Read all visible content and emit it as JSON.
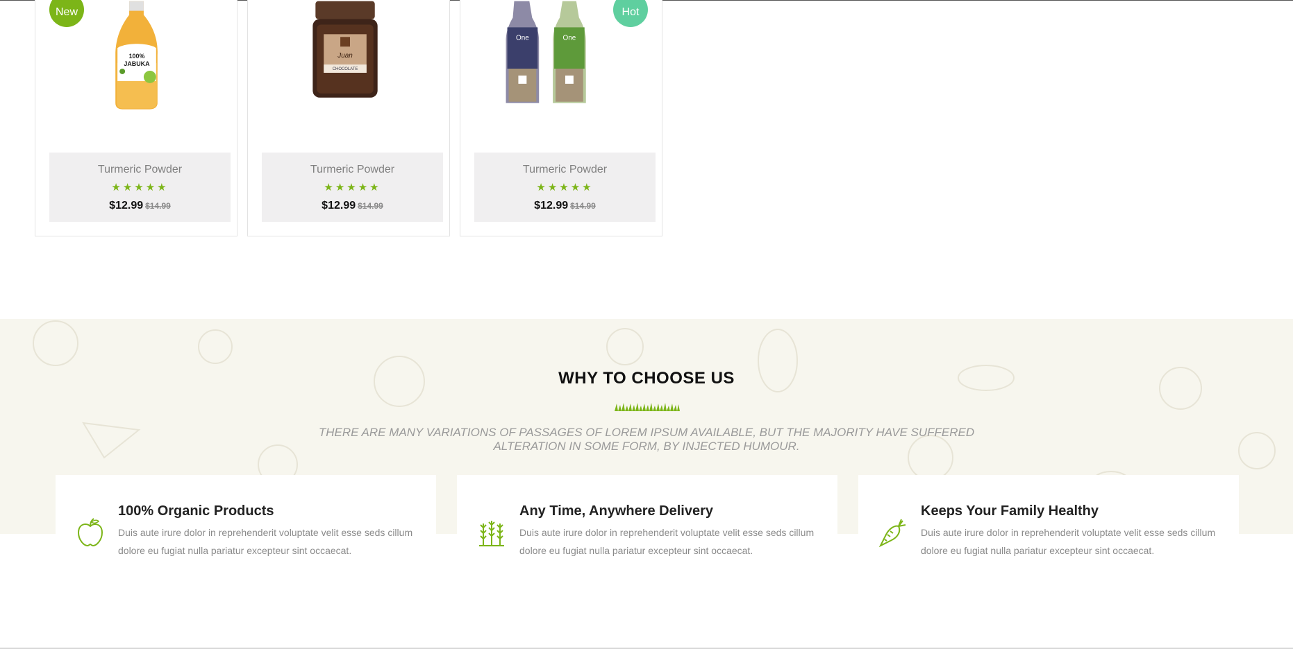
{
  "products": [
    {
      "name": "Turmeric Powder",
      "stars": "★★★★★",
      "price": "$12.99",
      "old_price": "$14.99",
      "badge": "New",
      "image": "juice-bottle"
    },
    {
      "name": "Turmeric Powder",
      "stars": "★★★★★",
      "price": "$12.99",
      "old_price": "$14.99",
      "badge": "",
      "image": "coffee-jar"
    },
    {
      "name": "Turmeric Powder",
      "stars": "★★★★★",
      "price": "$12.99",
      "old_price": "$14.99",
      "badge": "Hot",
      "image": "bread-bags"
    }
  ],
  "why": {
    "title": "WHY TO CHOOSE US",
    "subtitle": "THERE ARE MANY VARIATIONS OF PASSAGES OF LOREM IPSUM AVAILABLE, BUT THE MAJORITY HAVE SUFFERED ALTERATION IN SOME FORM, BY INJECTED HUMOUR.",
    "features": [
      {
        "title": "100% Organic Products",
        "desc": "Duis aute irure dolor in reprehenderit voluptate velit esse seds cillum dolore eu fugiat nulla pariatur excepteur sint occaecat.",
        "icon": "apple-icon"
      },
      {
        "title": "Any Time, Anywhere Delivery",
        "desc": "Duis aute irure dolor in reprehenderit voluptate velit esse seds cillum dolore eu fugiat nulla pariatur excepteur sint occaecat.",
        "icon": "wheat-icon"
      },
      {
        "title": "Keeps Your Family Healthy",
        "desc": "Duis aute irure dolor in reprehenderit voluptate velit esse seds cillum dolore eu fugiat nulla pariatur excepteur sint occaecat.",
        "icon": "carrot-icon"
      }
    ]
  },
  "colors": {
    "accent": "#7cb518",
    "hot": "#5fcf9f",
    "section_bg": "#f7f6ee",
    "info_bg": "#f0eff0"
  }
}
